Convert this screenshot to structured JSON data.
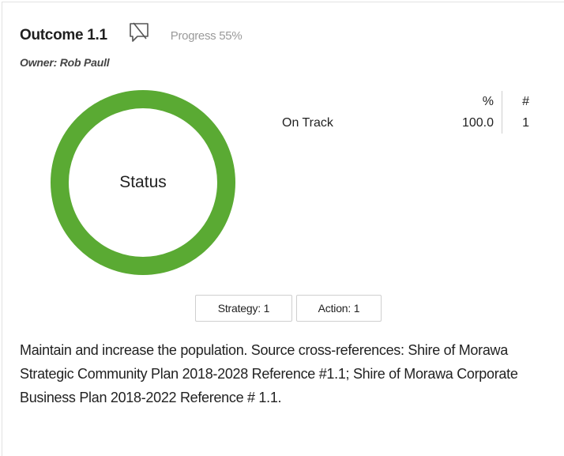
{
  "outcome": {
    "title": "Outcome 1.1",
    "progress_label": "Progress 55%",
    "owner": "Owner: Rob Paull",
    "comment_icon": "comment-slash-icon"
  },
  "chart_data": {
    "type": "pie",
    "center_label": "Status",
    "slices": [
      {
        "name": "On Track",
        "value": 100.0,
        "count": 1,
        "color": "#5aaa33"
      }
    ]
  },
  "status_table": {
    "headers": {
      "name": "",
      "pct": "%",
      "count": "#"
    },
    "rows": [
      {
        "name": "On Track",
        "pct": "100.0",
        "count": "1"
      }
    ]
  },
  "chips": {
    "strategy": "Strategy: 1",
    "action": "Action: 1"
  },
  "description": "Maintain and increase the population. Source cross-references: Shire of Morawa Strategic Community Plan 2018-2028 Reference #1.1; Shire of Morawa Corporate Business Plan 2018-2022 Reference # 1.1."
}
